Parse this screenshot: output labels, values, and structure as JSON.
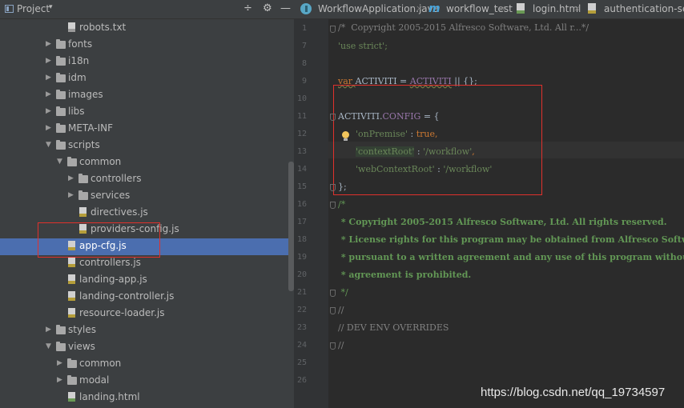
{
  "project_panel": {
    "title": "Project",
    "dropdown": "▾",
    "buttons": [
      "÷",
      "⚙",
      "—"
    ],
    "tree": [
      {
        "label": "robots.txt",
        "kind": "file",
        "ftype": "txt",
        "depth": 4
      },
      {
        "label": "fonts",
        "kind": "folder",
        "depth": 2,
        "expanded": false
      },
      {
        "label": "i18n",
        "kind": "folder",
        "depth": 2,
        "expanded": false
      },
      {
        "label": "idm",
        "kind": "folder",
        "depth": 2,
        "expanded": false
      },
      {
        "label": "images",
        "kind": "folder",
        "depth": 2,
        "expanded": false
      },
      {
        "label": "libs",
        "kind": "folder",
        "depth": 2,
        "expanded": false
      },
      {
        "label": "META-INF",
        "kind": "folder",
        "depth": 2,
        "expanded": false
      },
      {
        "label": "scripts",
        "kind": "folder",
        "depth": 2,
        "expanded": true
      },
      {
        "label": "common",
        "kind": "folder",
        "depth": 3,
        "expanded": true
      },
      {
        "label": "controllers",
        "kind": "folder",
        "depth": 4,
        "expanded": false
      },
      {
        "label": "services",
        "kind": "folder",
        "depth": 4,
        "expanded": false
      },
      {
        "label": "directives.js",
        "kind": "file",
        "ftype": "js",
        "depth": 5
      },
      {
        "label": "providers-config.js",
        "kind": "file",
        "ftype": "js",
        "depth": 5
      },
      {
        "label": "app-cfg.js",
        "kind": "file",
        "ftype": "js",
        "depth": 4,
        "selected": true
      },
      {
        "label": "controllers.js",
        "kind": "file",
        "ftype": "js",
        "depth": 4
      },
      {
        "label": "landing-app.js",
        "kind": "file",
        "ftype": "js",
        "depth": 4
      },
      {
        "label": "landing-controller.js",
        "kind": "file",
        "ftype": "js",
        "depth": 4
      },
      {
        "label": "resource-loader.js",
        "kind": "file",
        "ftype": "js",
        "depth": 4
      },
      {
        "label": "styles",
        "kind": "folder",
        "depth": 2,
        "expanded": false
      },
      {
        "label": "views",
        "kind": "folder",
        "depth": 2,
        "expanded": true
      },
      {
        "label": "common",
        "kind": "folder",
        "depth": 3,
        "expanded": false
      },
      {
        "label": "modal",
        "kind": "folder",
        "depth": 3,
        "expanded": false
      },
      {
        "label": "landing.html",
        "kind": "file",
        "ftype": "html",
        "depth": 4
      }
    ]
  },
  "tabs": [
    {
      "label": "WorkflowApplication.java",
      "close": "×"
    },
    {
      "label": "workflow_test",
      "close": "×"
    },
    {
      "label": "login.html",
      "close": "×"
    },
    {
      "label": "authentication-service",
      "close": ""
    }
  ],
  "editor": {
    "line_numbers": [
      "1",
      "7",
      "8",
      "9",
      "10",
      "11",
      "12",
      "13",
      "14",
      "15",
      "16",
      "17",
      "18",
      "19",
      "20",
      "21",
      "22",
      "23",
      "24",
      "25",
      "26"
    ],
    "code": {
      "l1": "/*  Copyright 2005-2015 Alfresco Software, Ltd. All r...*/",
      "l7": "'use strict';",
      "l9_var": "var ",
      "l9_name": "ACTIVITI",
      "l9_eq": " = ",
      "l9_ref": "ACTIVITI",
      "l9_rest": " || {};",
      "l11_obj": "ACTIVITI.",
      "l11_prop": "CONFIG",
      "l11_rest": " = {",
      "l12_key": "'onPremise'",
      "l12_colon": " : ",
      "l12_val": "true",
      "l12_comma": ",",
      "l13_key": "'contextRoot'",
      "l13_colon": " : ",
      "l13_val": "'/workflow'",
      "l13_comma": ",",
      "l14_key": "'webContextRoot'",
      "l14_colon": " : ",
      "l14_val": "'/workflow'",
      "l15": "};",
      "l16": "/*",
      "l17": " * Copyright 2005-2015 Alfresco Software, Ltd. All rights reserved.",
      "l18": " * License rights for this program may be obtained from Alfresco Software",
      "l19": " * pursuant to a written agreement and any use of this program without",
      "l20": " * agreement is prohibited.",
      "l21": " */",
      "l22": "//",
      "l23": "// DEV ENV OVERRIDES",
      "l24": "//"
    }
  },
  "watermark": "https://blog.csdn.net/qq_19734597",
  "colors": {
    "selection": "#4b6eaf",
    "highlight_box": "#e0312c",
    "panel_bg": "#3c3f41",
    "editor_bg": "#2b2b2b"
  }
}
